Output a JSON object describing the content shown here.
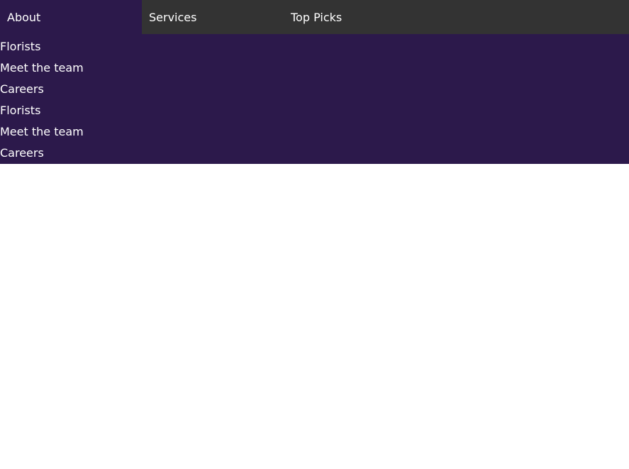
{
  "nav": {
    "tabs": [
      {
        "label": "About"
      },
      {
        "label": "Services"
      },
      {
        "label": "Top Picks"
      }
    ]
  },
  "dropdown": {
    "items": [
      {
        "label": "Florists"
      },
      {
        "label": "Meet the team"
      },
      {
        "label": "Careers"
      },
      {
        "label": "Florists"
      },
      {
        "label": "Meet the team"
      },
      {
        "label": "Careers"
      }
    ]
  },
  "colors": {
    "nav_background": "#333333",
    "active_background": "#2c194b",
    "text": "#ffffff",
    "page_background": "#ffffff"
  }
}
